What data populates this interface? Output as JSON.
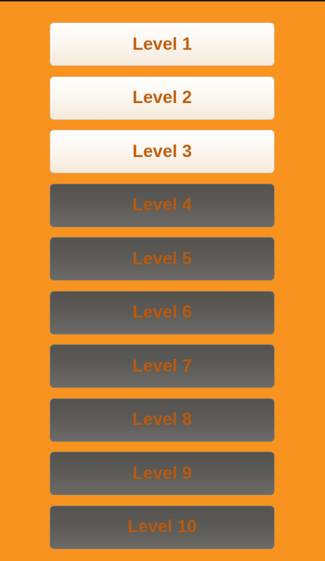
{
  "theme": {
    "background": "#f7931e",
    "text": "#c0600f",
    "unlocked_fill": "#fbf5ee",
    "locked_fill": "#5b5a56"
  },
  "levels": [
    {
      "label": "Level 1",
      "state": "unlocked"
    },
    {
      "label": "Level 2",
      "state": "unlocked"
    },
    {
      "label": "Level 3",
      "state": "unlocked"
    },
    {
      "label": "Level 4",
      "state": "locked"
    },
    {
      "label": "Level 5",
      "state": "locked"
    },
    {
      "label": "Level 6",
      "state": "locked"
    },
    {
      "label": "Level 7",
      "state": "locked"
    },
    {
      "label": "Level 8",
      "state": "locked"
    },
    {
      "label": "Level 9",
      "state": "locked"
    },
    {
      "label": "Level 10",
      "state": "locked"
    }
  ]
}
